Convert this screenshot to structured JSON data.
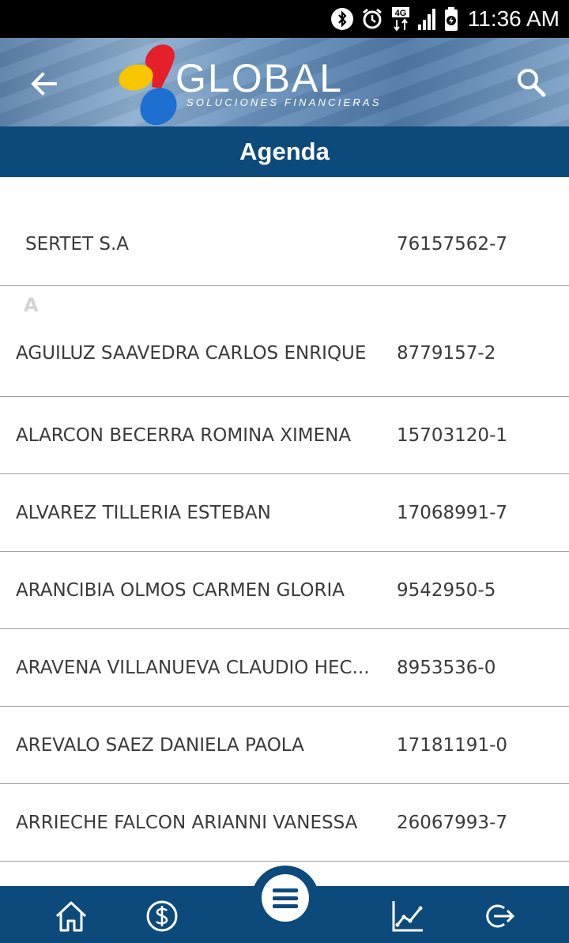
{
  "status_bar": {
    "time": "11:36 AM",
    "network_label": "4G",
    "icons": [
      "bluetooth-icon",
      "alarm-icon",
      "4g-icon",
      "signal-icon",
      "battery-charging-icon"
    ]
  },
  "header": {
    "logo_text": "GLOBAL",
    "logo_subtitle": "SOLUCIONES FINANCIERAS",
    "back_icon": "arrow-left-icon",
    "search_icon": "search-icon"
  },
  "title": "Agenda",
  "contacts": {
    "top": {
      "name": "SERTET S.A",
      "rut": "76157562-7"
    },
    "section_a": "A",
    "first_a": {
      "name": "AGUILUZ SAAVEDRA CARLOS ENRIQUE",
      "rut": "8779157-2"
    },
    "rows": [
      {
        "name": "ALARCON BECERRA ROMINA XIMENA",
        "rut": "15703120-1"
      },
      {
        "name": "ALVAREZ TILLERIA ESTEBAN",
        "rut": "17068991-7"
      },
      {
        "name": "ARANCIBIA OLMOS CARMEN GLORIA",
        "rut": "9542950-5"
      },
      {
        "name": "ARAVENA VILLANUEVA CLAUDIO HEC...",
        "rut": "8953536-0"
      },
      {
        "name": "AREVALO SAEZ DANIELA PAOLA",
        "rut": "17181191-0"
      },
      {
        "name": "ARRIECHE FALCON ARIANNI VANESSA",
        "rut": "26067993-7"
      }
    ]
  },
  "bottom_nav": {
    "items": [
      "home-icon",
      "dollar-icon",
      "menu-icon",
      "chart-icon",
      "logout-icon"
    ]
  },
  "colors": {
    "primary": "#0d4a7c",
    "logo_red": "#e5202b",
    "logo_yellow": "#f7c600",
    "logo_blue": "#1e6fd2",
    "divider": "#9a9a9a"
  }
}
